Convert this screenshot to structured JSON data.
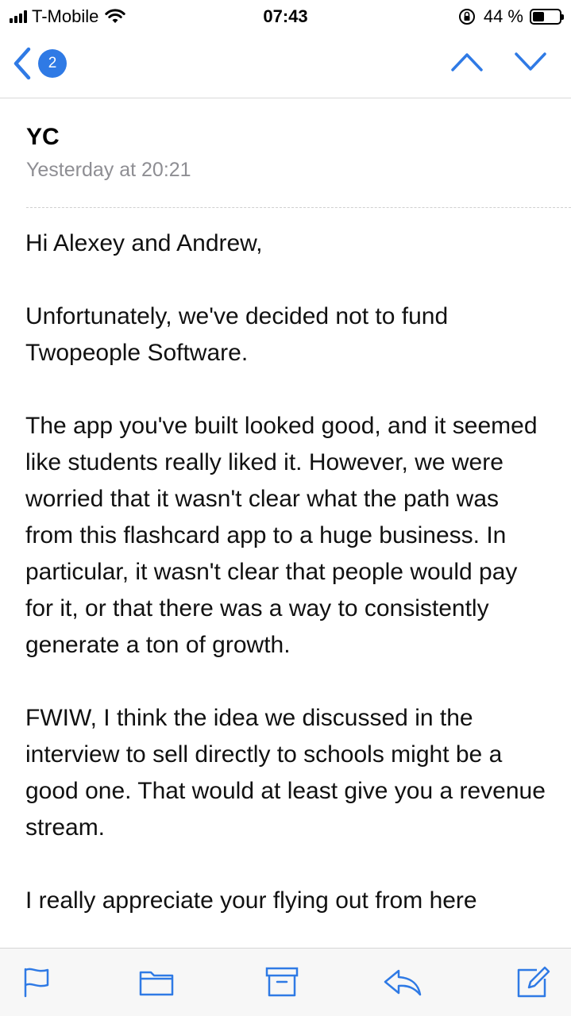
{
  "status_bar": {
    "carrier": "T-Mobile",
    "time": "07:43",
    "battery_text": "44 %",
    "battery_level": 0.44
  },
  "nav": {
    "back_badge_count": "2",
    "icons": [
      "chevron-left-icon",
      "chevron-up-icon",
      "chevron-down-icon"
    ],
    "accent_color": "#2f7ae5"
  },
  "message": {
    "sender": "YC",
    "date": "Yesterday at 20:21",
    "paragraphs": [
      "Hi Alexey and Andrew,",
      "Unfortunately, we've decided not to fund Twopeople Software.",
      "The app you've built looked good, and it seemed like students really liked it. However, we were worried that it wasn't clear what the path was from this flashcard app to a huge business.  In particular, it wasn't clear that people would pay for it, or that there was a way to consistently generate a ton of growth.",
      "FWIW, I think the idea we discussed in the interview to sell directly to schools might be a good one.  That would at least give you a revenue stream.",
      "I really appreciate your flying out from here"
    ]
  },
  "toolbar": {
    "icons": [
      "flag-icon",
      "folder-icon",
      "archive-icon",
      "reply-icon",
      "compose-icon"
    ]
  }
}
